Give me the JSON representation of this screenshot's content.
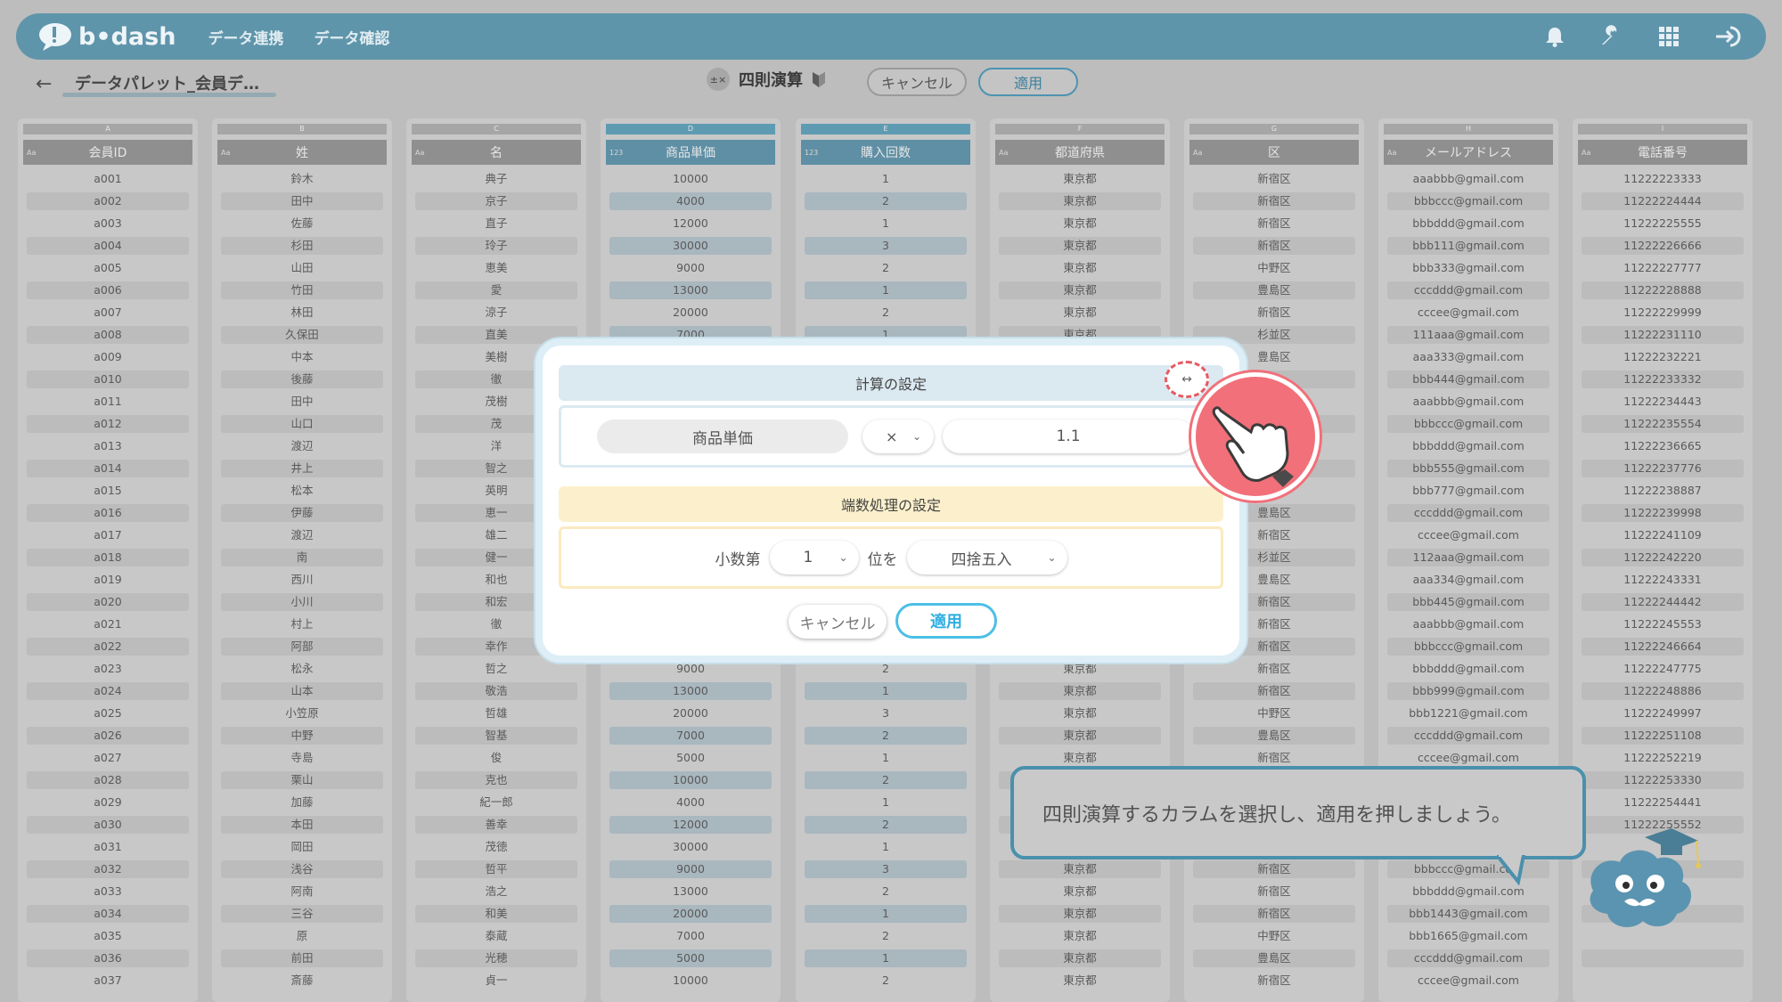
{
  "app": {
    "logo": "b•dash",
    "nav": [
      "データ連携",
      "データ確認"
    ]
  },
  "subheader": {
    "breadcrumb": "データパレット_会員デ…",
    "operation_label": "四則演算",
    "cancel": "キャンセル",
    "apply": "適用"
  },
  "sheet": {
    "columns": [
      {
        "letter": "A",
        "type": "Aa",
        "name": "会員ID",
        "numeric": false,
        "cells": [
          "a001",
          "a002",
          "a003",
          "a004",
          "a005",
          "a006",
          "a007",
          "a008",
          "a009",
          "a010",
          "a011",
          "a012",
          "a013",
          "a014",
          "a015",
          "a016",
          "a017",
          "a018",
          "a019",
          "a020",
          "a021",
          "a022",
          "a023",
          "a024",
          "a025",
          "a026",
          "a027",
          "a028",
          "a029",
          "a030",
          "a031",
          "a032",
          "a033",
          "a034",
          "a035",
          "a036",
          "a037"
        ]
      },
      {
        "letter": "B",
        "type": "Aa",
        "name": "姓",
        "numeric": false,
        "cells": [
          "鈴木",
          "田中",
          "佐藤",
          "杉田",
          "山田",
          "竹田",
          "林田",
          "久保田",
          "中本",
          "後藤",
          "田中",
          "山口",
          "渡辺",
          "井上",
          "松本",
          "伊藤",
          "渡辺",
          "南",
          "西川",
          "小川",
          "村上",
          "阿部",
          "松永",
          "山本",
          "小笠原",
          "中野",
          "寺島",
          "栗山",
          "加藤",
          "本田",
          "岡田",
          "浅谷",
          "阿南",
          "三谷",
          "原",
          "前田",
          "斎藤"
        ]
      },
      {
        "letter": "C",
        "type": "Aa",
        "name": "名",
        "numeric": false,
        "cells": [
          "典子",
          "京子",
          "直子",
          "玲子",
          "恵美",
          "愛",
          "涼子",
          "直美",
          "美樹",
          "徹",
          "茂樹",
          "茂",
          "洋",
          "智之",
          "英明",
          "恵一",
          "雄二",
          "健一",
          "和也",
          "和宏",
          "徹",
          "幸作",
          "哲之",
          "敬浩",
          "哲雄",
          "智基",
          "俊",
          "克也",
          "紀一郎",
          "善幸",
          "茂徳",
          "哲平",
          "浩之",
          "和美",
          "泰蔵",
          "光穂",
          "貞一"
        ]
      },
      {
        "letter": "D",
        "type": "123",
        "name": "商品単価",
        "numeric": true,
        "cells": [
          "10000",
          "4000",
          "12000",
          "30000",
          "9000",
          "13000",
          "20000",
          "7000",
          "",
          "",
          "",
          "",
          "",
          "",
          "",
          "",
          "",
          "",
          "",
          "",
          "",
          "",
          "9000",
          "13000",
          "20000",
          "7000",
          "5000",
          "10000",
          "4000",
          "12000",
          "30000",
          "9000",
          "13000",
          "20000",
          "7000",
          "5000",
          "10000"
        ]
      },
      {
        "letter": "E",
        "type": "123",
        "name": "購入回数",
        "numeric": true,
        "cells": [
          "1",
          "2",
          "1",
          "3",
          "2",
          "1",
          "2",
          "1",
          "",
          "",
          "",
          "",
          "",
          "",
          "",
          "",
          "",
          "",
          "",
          "",
          "",
          "",
          "2",
          "1",
          "3",
          "2",
          "1",
          "2",
          "1",
          "2",
          "1",
          "3",
          "2",
          "1",
          "2",
          "1",
          "2"
        ]
      },
      {
        "letter": "F",
        "type": "Aa",
        "name": "都道府県",
        "numeric": false,
        "cells": [
          "東京都",
          "東京都",
          "東京都",
          "東京都",
          "東京都",
          "東京都",
          "東京都",
          "東京都",
          "",
          "",
          "",
          "",
          "",
          "",
          "",
          "",
          "",
          "",
          "",
          "",
          "",
          "",
          "東京都",
          "東京都",
          "東京都",
          "東京都",
          "東京都",
          "",
          "",
          "",
          "",
          "東京都",
          "東京都",
          "東京都",
          "東京都",
          "東京都",
          "東京都"
        ]
      },
      {
        "letter": "G",
        "type": "Aa",
        "name": "区",
        "numeric": false,
        "cells": [
          "新宿区",
          "新宿区",
          "新宿区",
          "新宿区",
          "中野区",
          "豊島区",
          "新宿区",
          "杉並区",
          "豊島区",
          "",
          "",
          "",
          "",
          "",
          "",
          "豊島区",
          "新宿区",
          "杉並区",
          "豊島区",
          "新宿区",
          "新宿区",
          "新宿区",
          "新宿区",
          "新宿区",
          "中野区",
          "豊島区",
          "新宿区",
          "",
          "",
          "",
          "",
          "新宿区",
          "新宿区",
          "新宿区",
          "中野区",
          "豊島区",
          "新宿区"
        ]
      },
      {
        "letter": "H",
        "type": "Aa",
        "name": "メールアドレス",
        "numeric": false,
        "cells": [
          "aaabbb@gmail.com",
          "bbbccc@gmail.com",
          "bbbddd@gmail.com",
          "bbb111@gmail.com",
          "bbb333@gmail.com",
          "cccddd@gmail.com",
          "cccee@gmail.com",
          "111aaa@gmail.com",
          "aaa333@gmail.com",
          "bbb444@gmail.com",
          "aaabbb@gmail.com",
          "bbbccc@gmail.com",
          "bbbddd@gmail.com",
          "bbb555@gmail.com",
          "bbb777@gmail.com",
          "cccddd@gmail.com",
          "cccee@gmail.com",
          "112aaa@gmail.com",
          "aaa334@gmail.com",
          "bbb445@gmail.com",
          "aaabbb@gmail.com",
          "bbbccc@gmail.com",
          "bbbddd@gmail.com",
          "bbb999@gmail.com",
          "bbb1221@gmail.com",
          "cccddd@gmail.com",
          "cccee@gmail.com",
          "",
          "",
          "",
          "",
          "bbbccc@gmail.com",
          "bbbddd@gmail.com",
          "bbb1443@gmail.com",
          "bbb1665@gmail.com",
          "cccddd@gmail.com",
          "cccee@gmail.com"
        ]
      },
      {
        "letter": "I",
        "type": "Aa",
        "name": "電話番号",
        "numeric": false,
        "cells": [
          "11222223333",
          "11222224444",
          "11222225555",
          "11222226666",
          "11222227777",
          "11222228888",
          "11222229999",
          "11222231110",
          "11222232221",
          "11222233332",
          "11222234443",
          "11222235554",
          "11222236665",
          "11222237776",
          "11222238887",
          "11222239998",
          "11222241109",
          "11222242220",
          "11222243331",
          "11222244442",
          "11222245553",
          "11222246664",
          "11222247775",
          "11222248886",
          "11222249997",
          "11222251108",
          "11222252219",
          "11222253330",
          "11222254441",
          "11222255552",
          "",
          "",
          "",
          "",
          "",
          "",
          ""
        ]
      }
    ]
  },
  "modal": {
    "calc_title": "計算の設定",
    "column_pill": "商品単価",
    "operator": "×",
    "value": "1.1",
    "rounding_title": "端数処理の設定",
    "decimal_prefix": "小数第",
    "decimal_place": "1",
    "decimal_suffix": "位を",
    "method": "四捨五入",
    "cancel": "キャンセル",
    "apply": "適用"
  },
  "tooltip": {
    "text": "四則演算するカラムを選択し、適用を押しましょう。"
  },
  "colors": {
    "nav": "#5f95ab",
    "accent": "#4cbfe6",
    "highlight": "#f1707a",
    "rounding": "#fcf0cc"
  }
}
